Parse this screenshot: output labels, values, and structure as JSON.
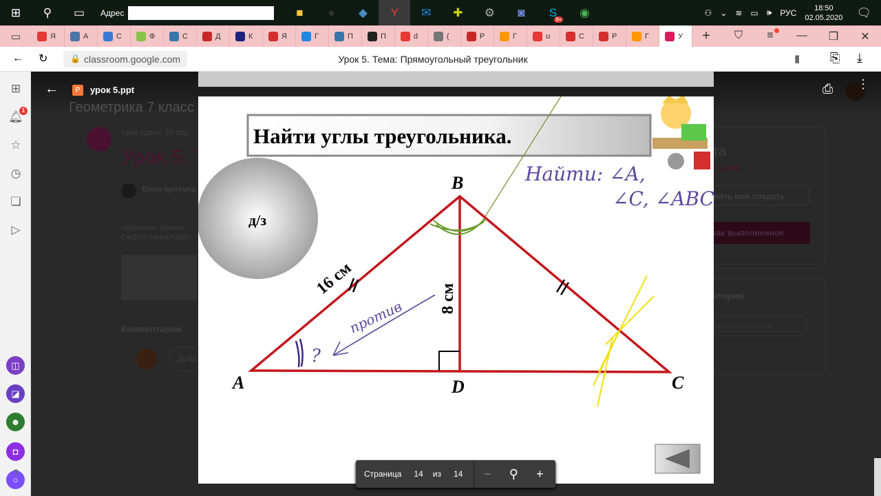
{
  "taskbar": {
    "address_label": "Адрес",
    "address_value": "",
    "language": "РУС",
    "time": "18:50",
    "date": "02.05.2020",
    "skype_badge": "9+"
  },
  "tabs": [
    {
      "letter": "Я",
      "color": "#e53935"
    },
    {
      "letter": "А",
      "color": "#4a76a8"
    },
    {
      "letter": "С",
      "color": "#3a7bd5"
    },
    {
      "letter": "Ф",
      "color": "#8bc34a"
    },
    {
      "letter": "С",
      "color": "#3776ab"
    },
    {
      "letter": "Д",
      "color": "#c62828"
    },
    {
      "letter": "К",
      "color": "#1a237e"
    },
    {
      "letter": "Я",
      "color": "#d32f2f"
    },
    {
      "letter": "Г",
      "color": "#1e88e5"
    },
    {
      "letter": "П",
      "color": "#3776ab"
    },
    {
      "letter": "П",
      "color": "#222222"
    },
    {
      "letter": "d",
      "color": "#e53935"
    },
    {
      "letter": "(",
      "color": "#777777"
    },
    {
      "letter": "Р",
      "color": "#c62828"
    },
    {
      "letter": "Г",
      "color": "#ff9800"
    },
    {
      "letter": "u",
      "color": "#e53935"
    },
    {
      "letter": "С",
      "color": "#d32f2f"
    },
    {
      "letter": "Р",
      "color": "#d32f2f"
    },
    {
      "letter": "Г",
      "color": "#ff9800"
    },
    {
      "letter": "У",
      "color": "#d81b60"
    }
  ],
  "urlbar": {
    "url": "classroom.google.com",
    "title": "Урок 5. Тема: Прямоугольный треугольник"
  },
  "sidebar": {
    "notification_count": "1"
  },
  "viewer": {
    "file_name": "урок 5.ppt",
    "file_icon_letter": "P"
  },
  "background": {
    "course": "Геометрика 7 класс",
    "due": "Срок сдачи: 20 апр.",
    "assignment_title": "Урок 5. Т",
    "author": "Elena Igorevna",
    "desc_line1": "переписать презент",
    "desc_line2": "СФОТОГРАФИРОВАТ",
    "comments": "Комментарии",
    "comment_placeholder": "Доба",
    "panel_title": "та",
    "panel_sub": "к сдачи",
    "add_create": "вить или создать",
    "mark_done": "как выполненное",
    "private_comments": "нтарии",
    "private_placeholder": "ить личный комм"
  },
  "slide": {
    "title": "Найти углы треугольника.",
    "homework": "д/з",
    "vertex_a": "A",
    "vertex_b": "B",
    "vertex_c": "C",
    "vertex_d": "D",
    "side_ab": "16 см",
    "side_bd": "8 см",
    "handwriting_find_line1": "Найти: ∠A,",
    "handwriting_find_line2": "∠C, ∠ABC!",
    "handwriting_against": "против",
    "handwriting_question": "?"
  },
  "pager": {
    "label": "Страница",
    "current": "14",
    "of": "из",
    "total": "14"
  }
}
